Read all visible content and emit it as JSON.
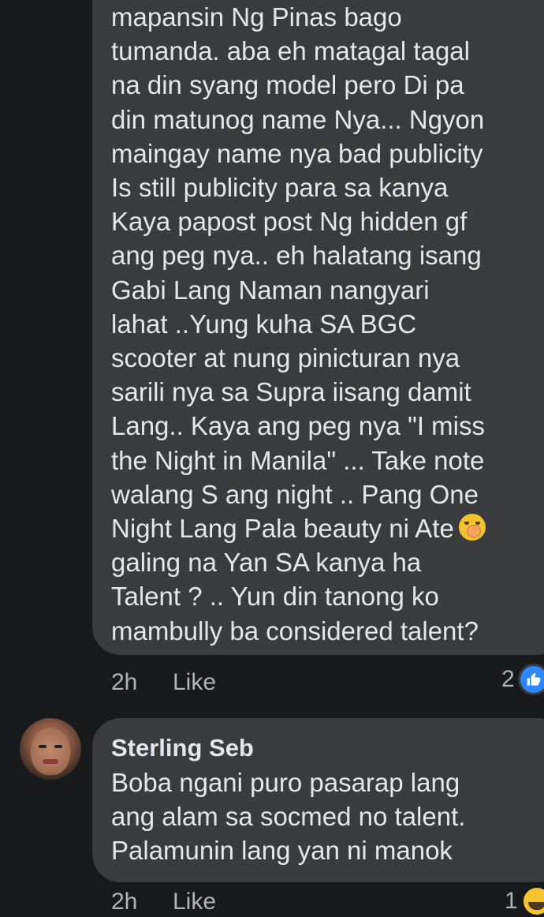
{
  "comment1": {
    "text": "mapansin Ng Pinas bago\ntumanda.  aba eh matagal tagal\nna din syang model pero Di pa\ndin matunog name Nya... Ngyon\nmaingay name nya bad publicity\nIs still publicity para sa kanya\nKaya papost post Ng hidden gf\nang peg nya..  eh halatang isang\nGabi Lang Naman nangyari\nlahat ..Yung kuha SA BGC\nscooter at nung pinicturan nya\nsarili nya sa Supra iisang damit\nLang.. Kaya ang peg nya \"I miss\nthe Night in Manila\"  ... Take note\nwalang S ang night .. Pang One\nNight Lang Pala beauty ni Ate",
    "text_after_emoji": "\ngaling na Yan SA kanya ha\nTalent ? .. Yun din tanong ko\nmambully ba considered talent?",
    "emoji": "face-with-hand-over-mouth-icon",
    "time": "2h",
    "like_label": "Like",
    "reaction_count": "2",
    "reaction_icon": "like-icon"
  },
  "comment2": {
    "author": "Sterling Seb",
    "text": "Boba ngani puro pasarap lang\nang alam sa socmed no talent.\nPalamunin lang yan ni manok",
    "time": "2h",
    "like_label": "Like",
    "reaction_count": "1",
    "reaction_icon": "haha-icon"
  },
  "colors": {
    "background": "#18191a",
    "bubble": "#3a3b3c",
    "text": "#e4e6eb",
    "secondary": "#b0b3b8",
    "like_blue": "#2d88ff"
  }
}
